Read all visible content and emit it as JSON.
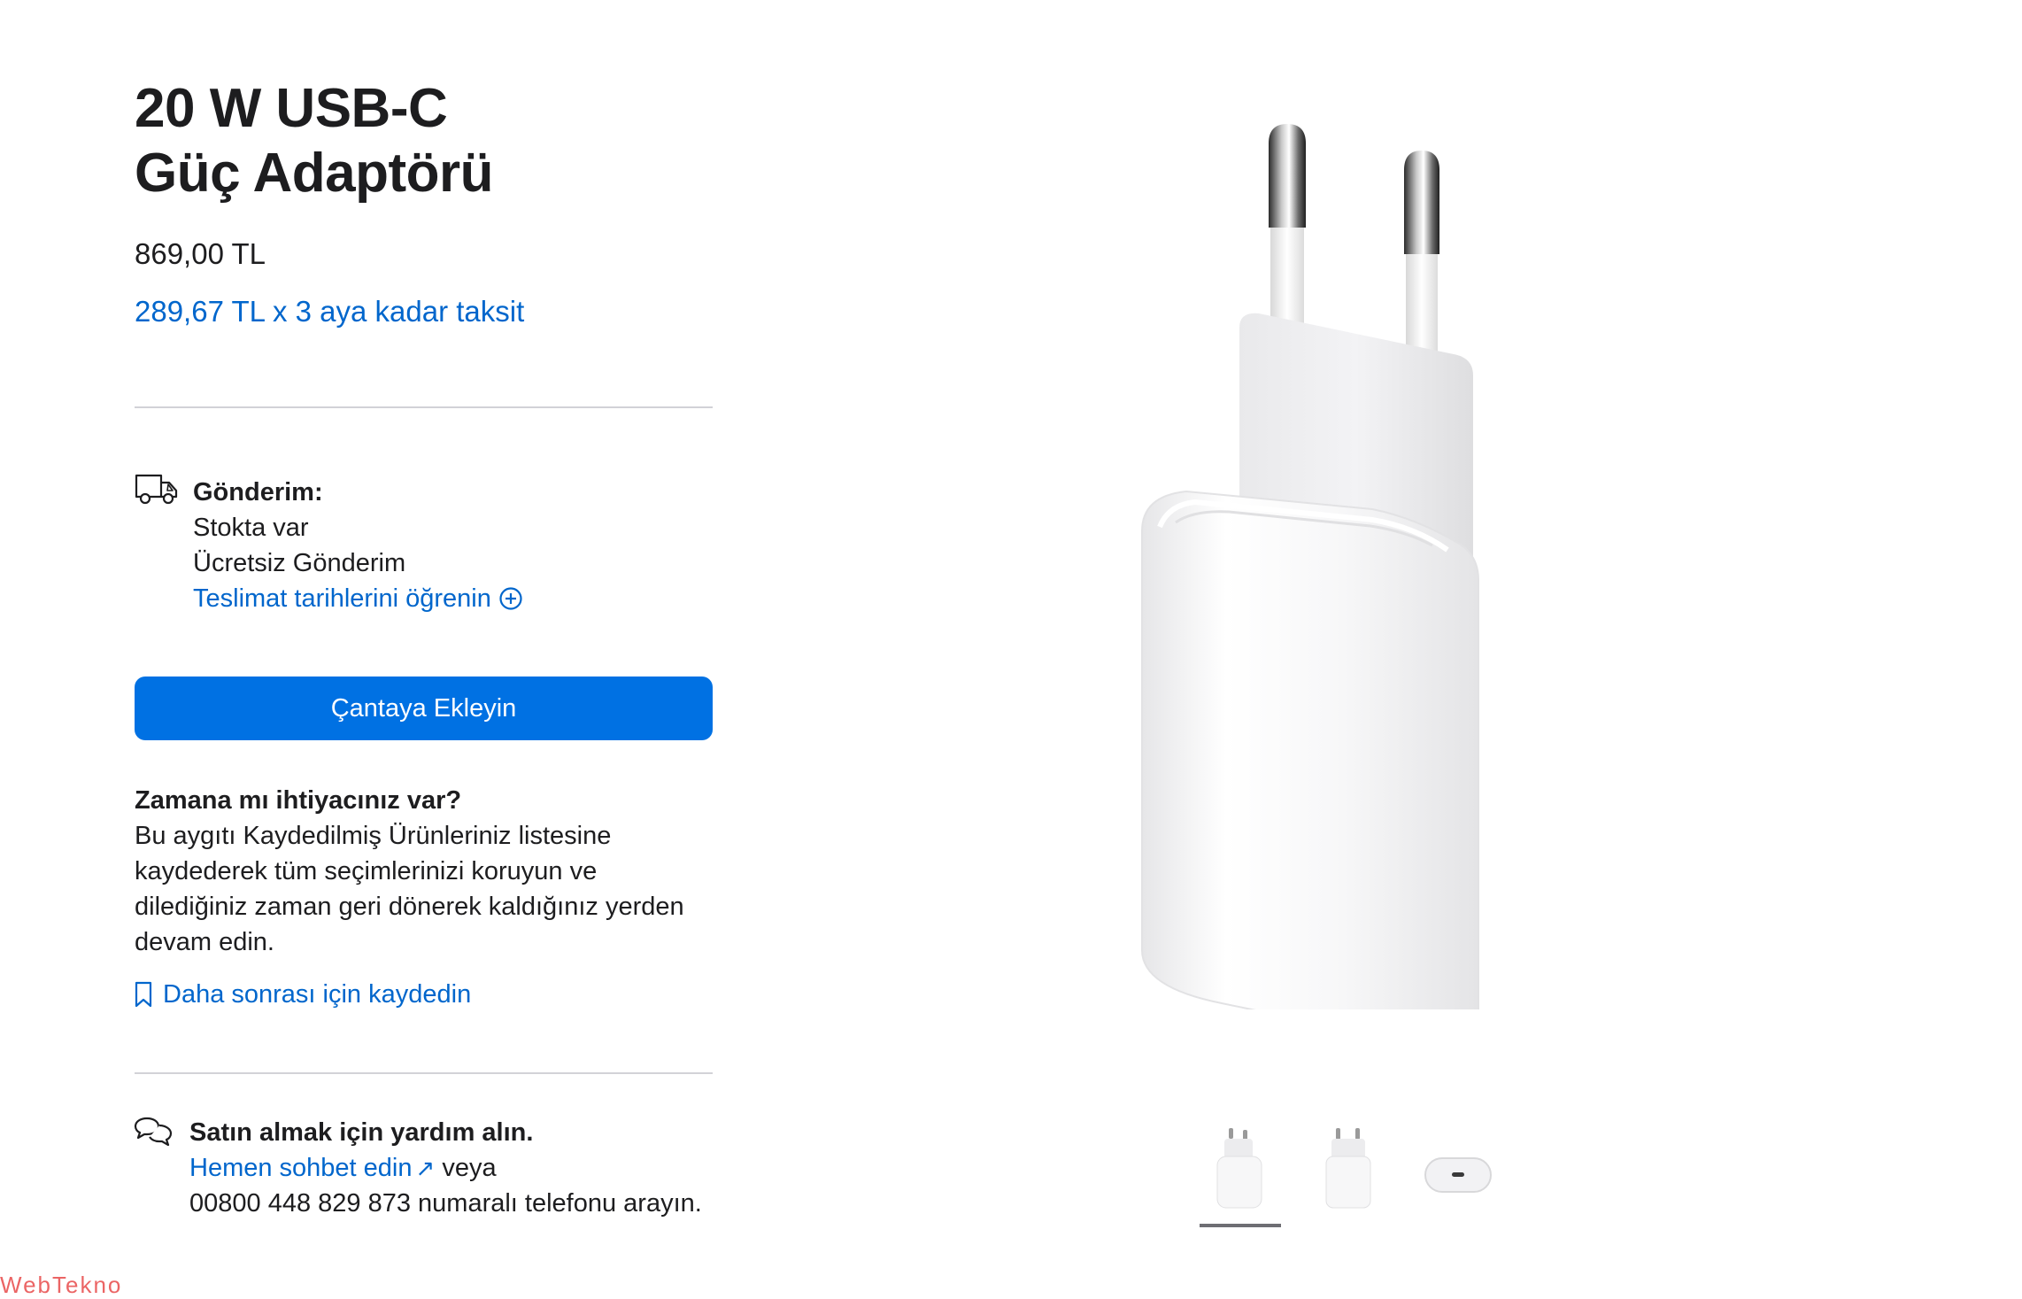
{
  "product": {
    "title_line1": "20 W USB-C",
    "title_line2": "Güç Adaptörü",
    "price": "869,00 TL",
    "installment": "289,67 TL x 3 aya kadar taksit"
  },
  "shipping": {
    "icon": "truck-icon",
    "label": "Gönderim:",
    "stock": "Stokta var",
    "free": "Ücretsiz Gönderim",
    "dates_link": "Teslimat tarihlerini öğrenin",
    "dates_icon": "plus-circle-icon"
  },
  "cta": {
    "add_to_bag": "Çantaya Ekleyin"
  },
  "save": {
    "heading": "Zamana mı ihtiyacınız var?",
    "body": "Bu aygıtı Kaydedilmiş Ürünleriniz listesine kaydederek tüm seçimlerinizi koruyun ve dilediğiniz zaman geri dönerek kaldığınız yerden devam edin.",
    "link": "Daha sonrası için kaydedin",
    "link_icon": "bookmark-icon"
  },
  "help": {
    "icon": "chat-bubbles-icon",
    "heading": "Satın almak için yardım alın.",
    "chat_link": "Hemen sohbet edin",
    "or": "veya",
    "phone_text": "00800 448 829 873 numaralı telefonu arayın."
  },
  "gallery": {
    "thumbnails": [
      "plug-front-thumbnail",
      "plug-angle-thumbnail",
      "usb-c-port-thumbnail"
    ],
    "selected_index": 0
  },
  "watermark": "WebTekno",
  "colors": {
    "link": "#0066cc",
    "button": "#0071e3",
    "text": "#1d1d1f",
    "divider": "#d2d2d7"
  }
}
